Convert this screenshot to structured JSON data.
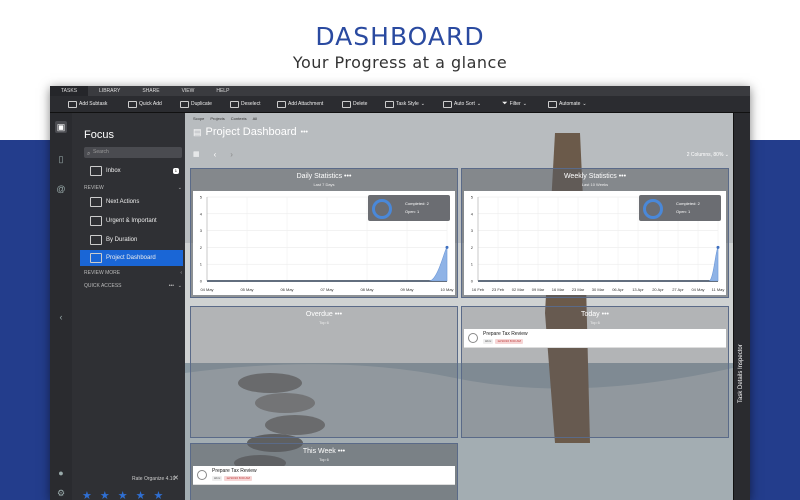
{
  "hero": {
    "title": "DASHBOARD",
    "subtitle": "Your Progress at a glance"
  },
  "tabs": [
    "TASKS",
    "LIBRARY",
    "SHARE",
    "VIEW",
    "HELP"
  ],
  "toolbar": {
    "add_subtask": "Add Subtask",
    "quick_add": "Quick Add",
    "duplicate": "Duplicate",
    "deselect": "Deselect",
    "add_attachment": "Add Attachment",
    "delete": "Delete",
    "task_style": "Task Style",
    "auto_sort": "Auto Sort",
    "filter": "Filter",
    "automate": "Automate"
  },
  "sidebar": {
    "title": "Focus",
    "search_placeholder": "Search",
    "inbox": {
      "label": "Inbox",
      "count": "1"
    },
    "review_header": "REVIEW",
    "items": [
      {
        "label": "Next Actions"
      },
      {
        "label": "Urgent & Important"
      },
      {
        "label": "By Duration"
      },
      {
        "label": "Project Dashboard"
      }
    ],
    "review_more": "REVIEW MORE",
    "quick_access": "QUICK ACCESS",
    "rating_text": "Rate Organize 4.10"
  },
  "breadcrumbs": [
    "Scope",
    "Projects",
    "Contexts",
    "All"
  ],
  "page": {
    "title": "Project Dashboard",
    "more": "•••",
    "columns": "2 Columns, 80%"
  },
  "panels": {
    "daily": {
      "title": "Daily Statistics",
      "subtitle": "Last 7 Days",
      "legend_completed": "Completed: 2",
      "legend_open": "Open: 1"
    },
    "weekly": {
      "title": "Weekly Statistics",
      "subtitle": "Last 10 Weeks",
      "legend_completed": "Completed: 2",
      "legend_open": "Open: 1"
    },
    "overdue": {
      "title": "Overdue",
      "subtitle": "Top 6"
    },
    "today": {
      "title": "Today",
      "subtitle": "Top 6",
      "task": "Prepare Tax Review",
      "tag1": "Hbrx",
      "tag2": "12/10/16 8:00 AM"
    },
    "thisweek": {
      "title": "This Week",
      "subtitle": "Top 6",
      "task": "Prepare Tax Review",
      "tag1": "Hbrx",
      "tag2": "12/10/16 8:00 AM"
    }
  },
  "inspector": {
    "label": "Task Details Inspector"
  },
  "chart_data": [
    {
      "type": "area",
      "title": "Daily Statistics",
      "x": [
        "04 May",
        "05 May",
        "06 May",
        "07 May",
        "08 May",
        "09 May",
        "10 May"
      ],
      "ylim": [
        0,
        5
      ],
      "yticks": [
        "0",
        "1",
        "2",
        "3",
        "4",
        "5"
      ],
      "series": [
        {
          "name": "Completed",
          "values": [
            0,
            0,
            0,
            0,
            0,
            0,
            2
          ]
        }
      ]
    },
    {
      "type": "area",
      "title": "Weekly Statistics",
      "x": [
        "16 Feb",
        "23 Feb",
        "02 Mar",
        "09 Mar",
        "16 Mar",
        "23 Mar",
        "30 Mar",
        "06 Apr",
        "13 Apr",
        "20 Apr",
        "27 Apr",
        "04 May",
        "11 May"
      ],
      "ylim": [
        0,
        5
      ],
      "yticks": [
        "0",
        "1",
        "2",
        "3",
        "4",
        "5"
      ],
      "series": [
        {
          "name": "Completed",
          "values": [
            0,
            0,
            0,
            0,
            0,
            0,
            0,
            0,
            0,
            0,
            0,
            0,
            2
          ]
        }
      ]
    }
  ],
  "colors": {
    "brand_blue": "#233d8c",
    "selection": "#1a66d6",
    "chart_area": "#8fb3e6"
  }
}
